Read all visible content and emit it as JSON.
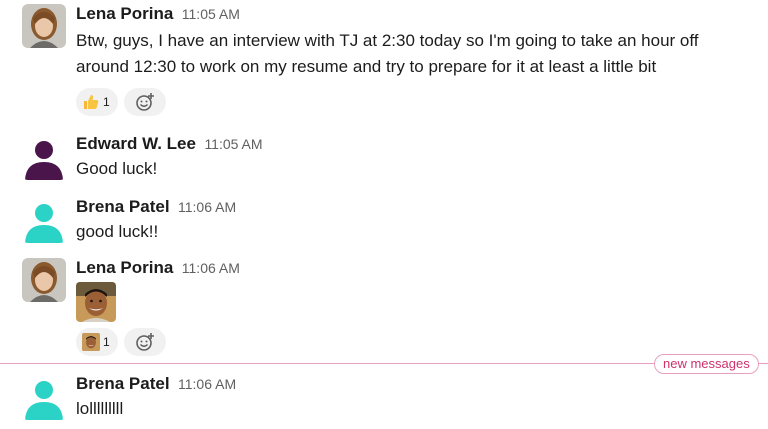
{
  "messages": [
    {
      "name": "Lena Porina",
      "time": "11:05 AM",
      "text_line1": "Btw, guys, I have an interview with TJ at 2:30 today so I'm going to take an hour off",
      "text_line2": "around 12:30 to work on my resume and try to prepare for it at least a little bit",
      "reaction_count": "1"
    },
    {
      "name": "Edward W. Lee",
      "time": "11:05 AM",
      "text": "Good luck!"
    },
    {
      "name": "Brena Patel",
      "time": "11:06 AM",
      "text": "good luck!!"
    },
    {
      "name": "Lena Porina",
      "time": "11:06 AM",
      "reaction_count": "1"
    },
    {
      "name": "Brena Patel",
      "time": "11:06 AM",
      "text": "lolllllllll"
    }
  ],
  "divider": {
    "label": "new messages"
  },
  "colors": {
    "edward_avatar": "#4a154b",
    "brena_avatar": "#2bd3c6",
    "new_messages": "#d0326a"
  },
  "icons": {
    "thumbs_up": "thumbs-up-emoji",
    "add_reaction": "add-reaction-icon",
    "face_emoji": "custom-face-emoji"
  }
}
